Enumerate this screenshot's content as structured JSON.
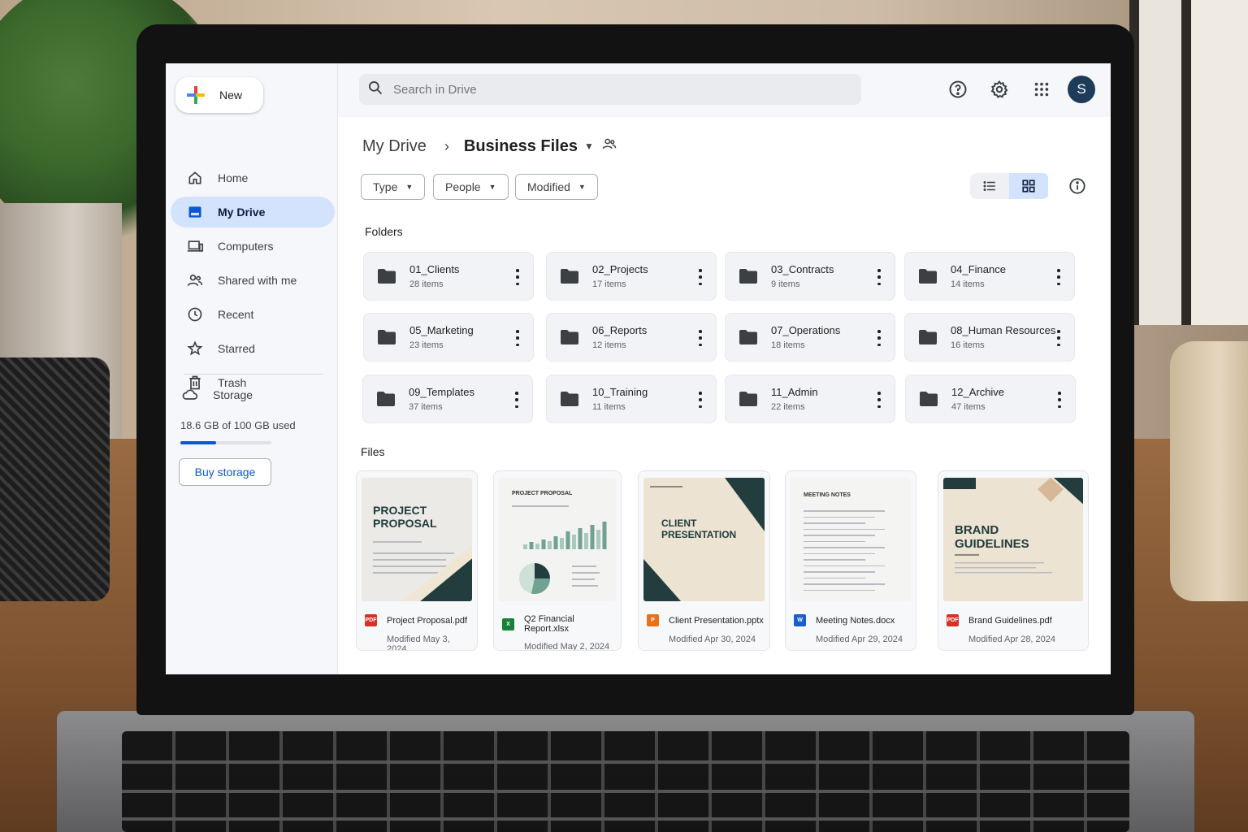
{
  "app": {
    "new_label": "New",
    "search_placeholder": "Search in Drive",
    "avatar_initial": "S"
  },
  "sidebar": {
    "items": [
      {
        "label": "Home",
        "icon": "home-icon",
        "active": false
      },
      {
        "label": "My Drive",
        "icon": "my-drive-icon",
        "active": true
      },
      {
        "label": "Computers",
        "icon": "computer-icon",
        "active": false
      },
      {
        "label": "Shared with me",
        "icon": "people-icon",
        "active": false
      },
      {
        "label": "Recent",
        "icon": "clock-icon",
        "active": false
      },
      {
        "label": "Starred",
        "icon": "star-icon",
        "active": false
      },
      {
        "label": "Trash",
        "icon": "trash-icon",
        "active": false
      }
    ],
    "storage_label": "Storage",
    "storage_used_text": "18.6 GB of 100 GB used",
    "storage_fraction": 0.186,
    "buy_storage_label": "Buy storage"
  },
  "breadcrumb": {
    "root": "My Drive",
    "current": "Business Files"
  },
  "filters": [
    "Type",
    "People",
    "Modified"
  ],
  "sections": {
    "folders_label": "Folders",
    "files_label": "Files"
  },
  "folders": [
    {
      "name": "01_Clients",
      "count": "28 items"
    },
    {
      "name": "02_Projects",
      "count": "17 items"
    },
    {
      "name": "03_Contracts",
      "count": "9 items"
    },
    {
      "name": "04_Finance",
      "count": "14 items"
    },
    {
      "name": "05_Marketing",
      "count": "23 items"
    },
    {
      "name": "06_Reports",
      "count": "12 items"
    },
    {
      "name": "07_Operations",
      "count": "18 items"
    },
    {
      "name": "08_Human Resources",
      "count": "16 items"
    },
    {
      "name": "09_Templates",
      "count": "37 items"
    },
    {
      "name": "10_Training",
      "count": "11 items"
    },
    {
      "name": "11_Admin",
      "count": "22 items"
    },
    {
      "name": "12_Archive",
      "count": "47 items"
    }
  ],
  "files": [
    {
      "name": "Project Proposal.pdf",
      "modified": "Modified May 3, 2024",
      "type": "pdf",
      "type_label": "PDF",
      "type_color": "#d93025",
      "thumb_title": "PROJECT\nPROPOSAL"
    },
    {
      "name": "Q2 Financial Report.xlsx",
      "modified": "Modified May 2, 2024",
      "type": "xlsx",
      "type_label": "X",
      "type_color": "#188038",
      "thumb_title": "PROJECT PROPOSAL"
    },
    {
      "name": "Client Presentation.pptx",
      "modified": "Modified Apr 30, 2024",
      "type": "pptx",
      "type_label": "P",
      "type_color": "#e8711a",
      "thumb_title": "CLIENT\nPRESENTATION"
    },
    {
      "name": "Meeting Notes.docx",
      "modified": "Modified Apr 29, 2024",
      "type": "docx",
      "type_label": "W",
      "type_color": "#1a5fd0",
      "thumb_title": "MEETING NOTES"
    },
    {
      "name": "Brand Guidelines.pdf",
      "modified": "Modified Apr 28, 2024",
      "type": "pdf",
      "type_label": "PDF",
      "type_color": "#d93025",
      "thumb_title": "BRAND\nGUIDELINES"
    }
  ],
  "colors": {
    "accent": "#0b57d0",
    "active_nav_bg": "#d3e3fd",
    "thumb_dark": "#233d3f",
    "thumb_beige": "#ece3d3"
  }
}
